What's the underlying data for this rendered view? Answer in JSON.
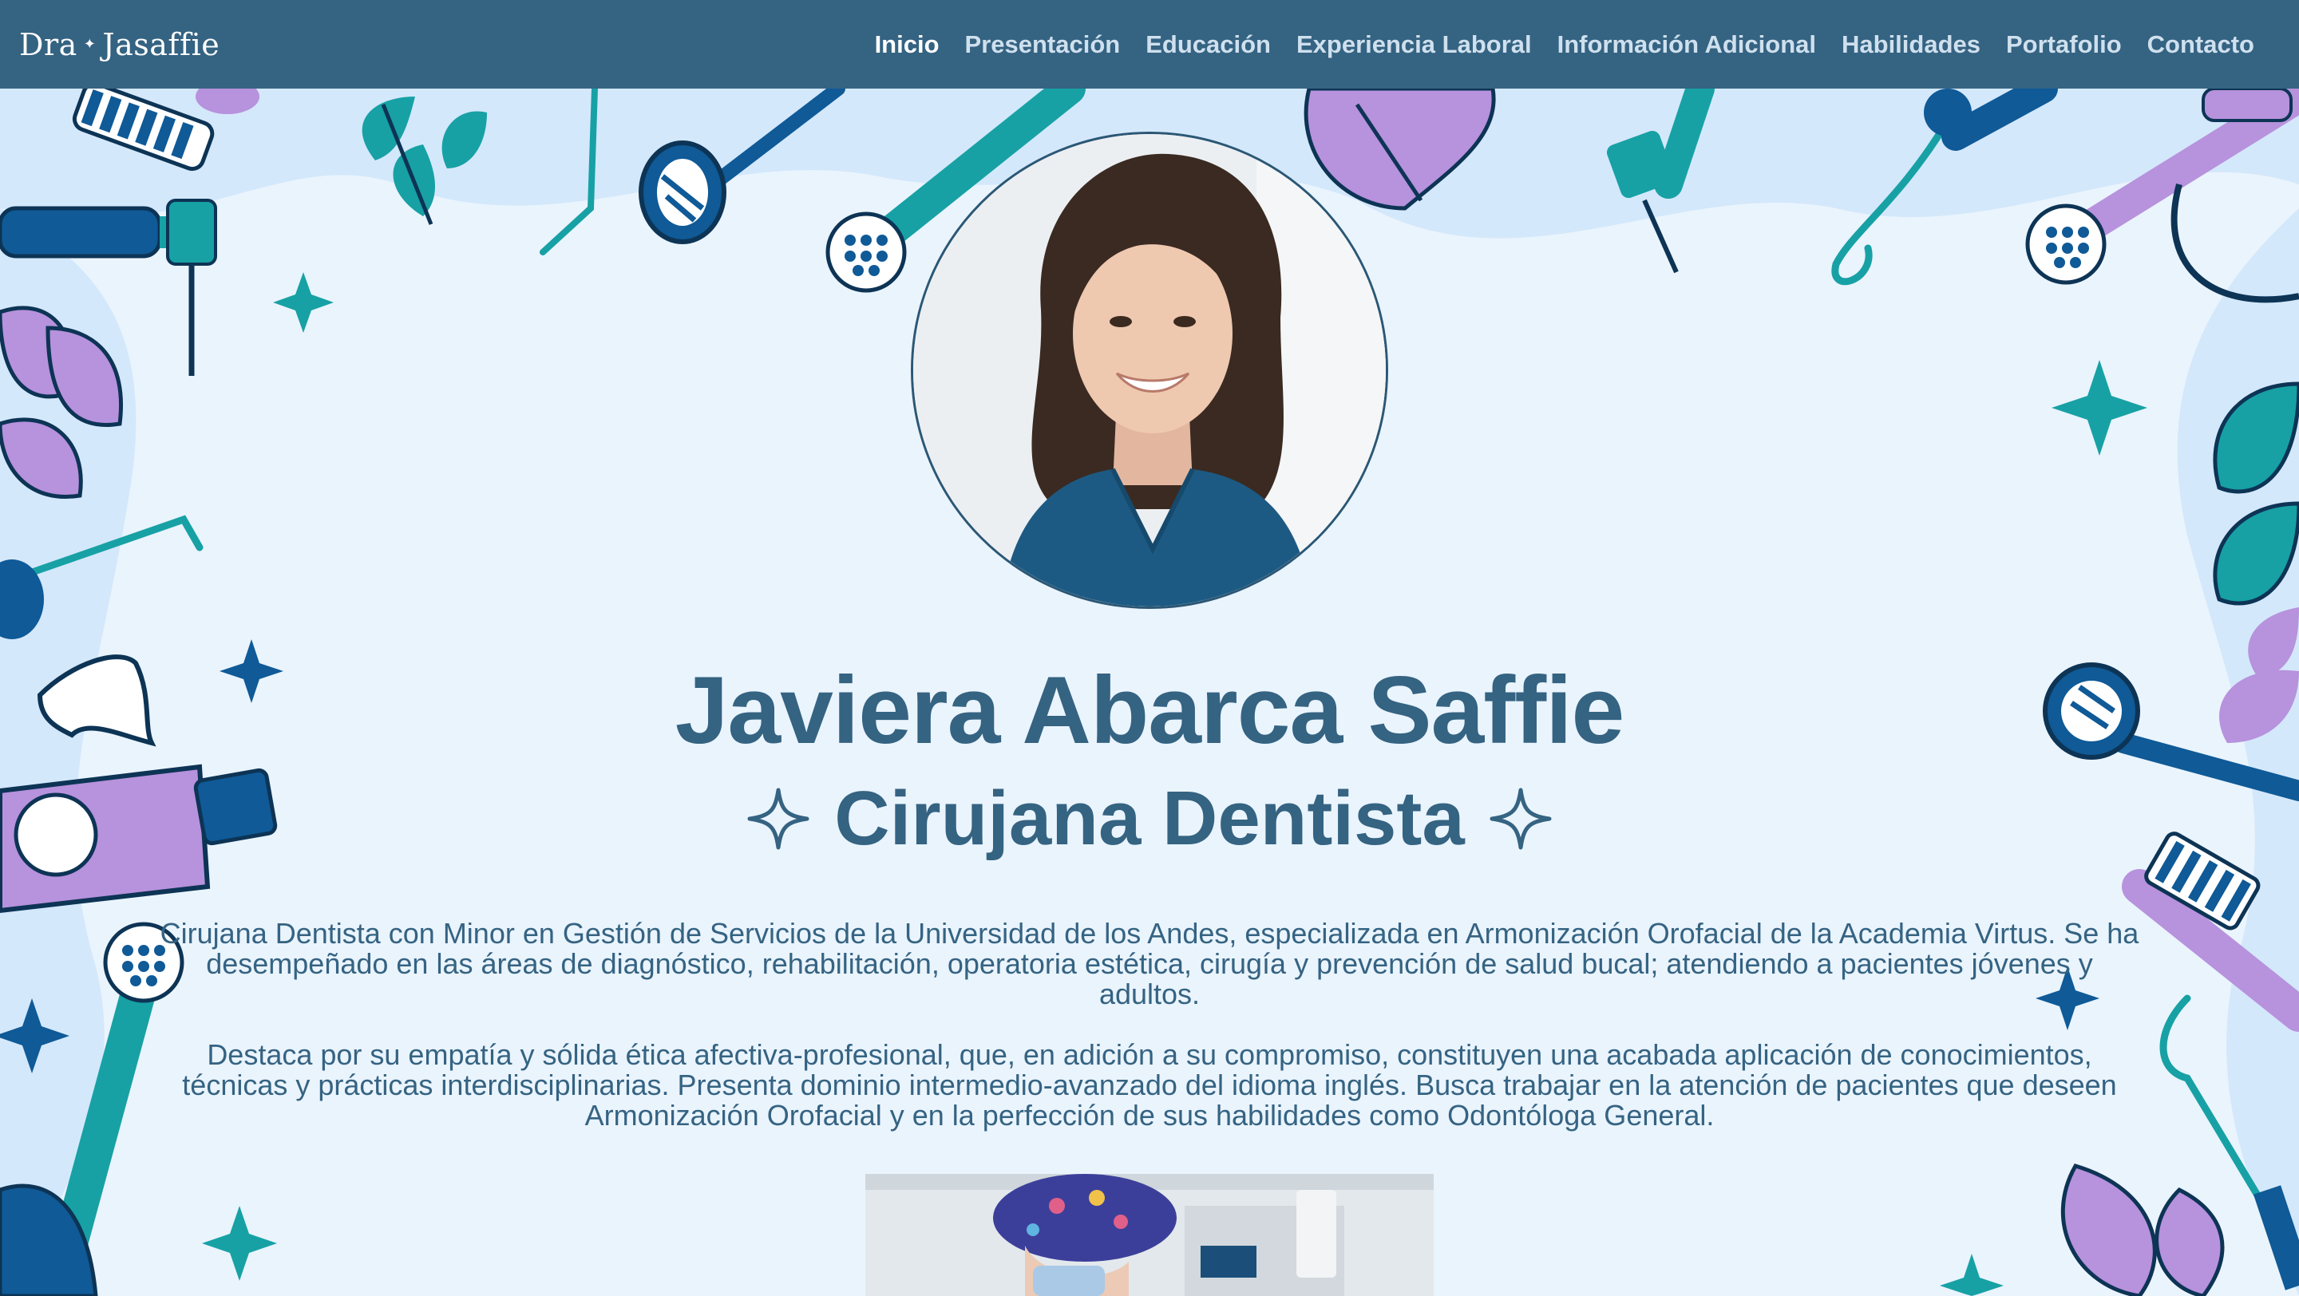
{
  "header": {
    "logo_text": "Dra",
    "logo_text2": "Jasaffie",
    "nav": [
      {
        "label": "Inicio",
        "active": true
      },
      {
        "label": "Presentación",
        "active": false
      },
      {
        "label": "Educación",
        "active": false
      },
      {
        "label": "Experiencia Laboral",
        "active": false
      },
      {
        "label": "Información Adicional",
        "active": false
      },
      {
        "label": "Habilidades",
        "active": false
      },
      {
        "label": "Portafolio",
        "active": false
      },
      {
        "label": "Contacto",
        "active": false
      }
    ]
  },
  "hero": {
    "name": "Javiera Abarca Saffie",
    "title": "Cirujana Dentista",
    "bio_paragraph_1": "Cirujana Dentista con Minor en Gestión de Servicios de la Universidad de los Andes, especializada en Armonización Orofacial de la Academia Virtus. Se ha desempeñado en las áreas de diagnóstico, rehabilitación, operatoria estética, cirugía y prevención de salud bucal; atendiendo a pacientes jóvenes y adultos.",
    "bio_paragraph_2": "Destaca por su empatía y sólida ética afectiva-profesional, que, en adición a su compromiso, constituyen una acabada aplicación de conocimientos, técnicas y prácticas interdisciplinarias. Presenta dominio intermedio-avanzado del idioma inglés. Busca trabajar en la atención de pacientes que deseen Armonización Orofacial y en la perfección de sus habilidades como Odontóloga General."
  },
  "colors": {
    "navbar": "#356382",
    "background": "#eaf4fd",
    "text_primary": "#356382",
    "teal": "#17a1a5",
    "purple": "#b792dd",
    "navy": "#0f5a97",
    "dark_navy": "#0d3455"
  },
  "icons": [
    "toothbrush-icon",
    "dental-mirror-icon",
    "dental-drill-icon",
    "leaf-icon",
    "sparkle-icon",
    "tooth-icon",
    "toothpaste-icon",
    "dental-probe-icon"
  ]
}
